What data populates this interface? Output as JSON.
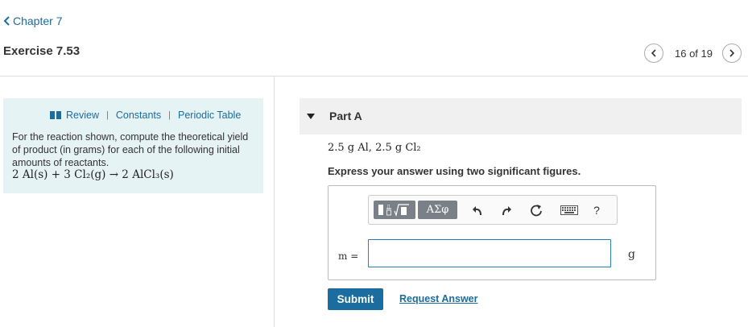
{
  "nav": {
    "chapter_label": "Chapter 7",
    "exercise_title": "Exercise 7.53",
    "pager_text": "16 of 19"
  },
  "info": {
    "links": [
      "Review",
      "Constants",
      "Periodic Table"
    ],
    "separator": "|",
    "problem_text": "For the reaction shown, compute the theoretical yield of product (in grams) for each of the following initial amounts of reactants.",
    "reaction_text": "2 Al(s) + 3 Cl₂(g) → 2 AlCl₃(s)"
  },
  "part": {
    "title": "Part A",
    "given_text": "2.5 g Al, 2.5 g Cl₂",
    "instruction": "Express your answer using two significant figures."
  },
  "answer": {
    "toolbar": {
      "greek_label": "ΑΣφ",
      "help_label": "?",
      "icons": [
        "templates-icon",
        "greek-letters-icon",
        "undo-icon",
        "redo-icon",
        "reset-icon",
        "keyboard-icon",
        "help-icon"
      ]
    },
    "variable_label": "m =",
    "input_value": "",
    "unit": "g"
  },
  "actions": {
    "submit_label": "Submit",
    "request_label": "Request Answer"
  },
  "colors": {
    "accent": "#1a6d9e",
    "info_bg": "#e5f3f5",
    "part_bg": "#f0f0f0",
    "toolbar_btn": "#7a8088"
  }
}
